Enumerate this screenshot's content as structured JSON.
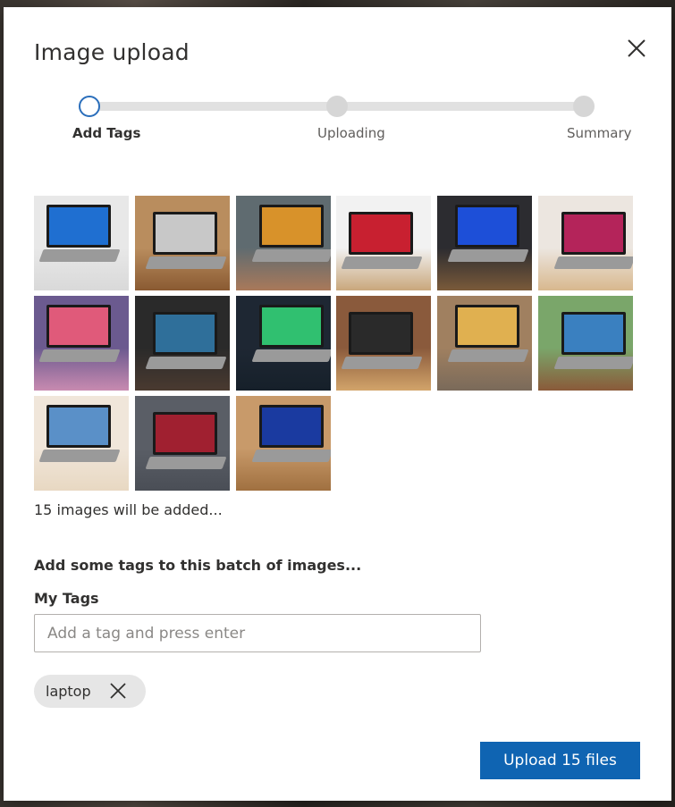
{
  "dialog": {
    "title": "Image upload",
    "close_icon": "close-icon"
  },
  "stepper": {
    "steps": [
      {
        "label": "Add Tags",
        "state": "active"
      },
      {
        "label": "Uploading",
        "state": "pending"
      },
      {
        "label": "Summary",
        "state": "pending"
      }
    ]
  },
  "images": {
    "thumbnails": [
      {
        "bg": "#e8e8e8",
        "screen": "#1f6fd1",
        "desk": "#d9d9d9"
      },
      {
        "bg": "#b98d5e",
        "screen": "#c8c8c8",
        "desk": "#8a5a32"
      },
      {
        "bg": "#5f6b70",
        "screen": "#d8922a",
        "desk": "#a9795a"
      },
      {
        "bg": "#f2f2f2",
        "screen": "#c82030",
        "desk": "#c9a77c"
      },
      {
        "bg": "#2c2c30",
        "screen": "#1d4fd8",
        "desk": "#7a5a3a"
      },
      {
        "bg": "#ece6e0",
        "screen": "#b4245a",
        "desk": "#d8b88e"
      },
      {
        "bg": "#6b5a8f",
        "screen": "#e05a7a",
        "desk": "#c88ab0"
      },
      {
        "bg": "#2a2a2a",
        "screen": "#2f6f9a",
        "desk": "#4a3a30"
      },
      {
        "bg": "#1e2733",
        "screen": "#30c070",
        "desk": "#16202a"
      },
      {
        "bg": "#8a5a3c",
        "screen": "#2a2a2a",
        "desk": "#d2a46a"
      },
      {
        "bg": "#a08060",
        "screen": "#e0b050",
        "desk": "#7a6a5a"
      },
      {
        "bg": "#7aa66a",
        "screen": "#3a80c0",
        "desk": "#8a5a3a"
      },
      {
        "bg": "#f0e6da",
        "screen": "#5a90c8",
        "desk": "#e8d8c2"
      },
      {
        "bg": "#5a5e66",
        "screen": "#a02030",
        "desk": "#4a4e56"
      },
      {
        "bg": "#c89a6a",
        "screen": "#1a3aa0",
        "desk": "#a07040"
      }
    ],
    "count_text": "15 images will be added..."
  },
  "tags": {
    "heading": "Add some tags to this batch of images...",
    "field_label": "My Tags",
    "input_value": "",
    "input_placeholder": "Add a tag and press enter",
    "chips": [
      {
        "label": "laptop"
      }
    ]
  },
  "footer": {
    "upload_label": "Upload 15 files"
  },
  "colors": {
    "accent": "#0f64b2",
    "active_step_border": "#2a6ebb"
  }
}
